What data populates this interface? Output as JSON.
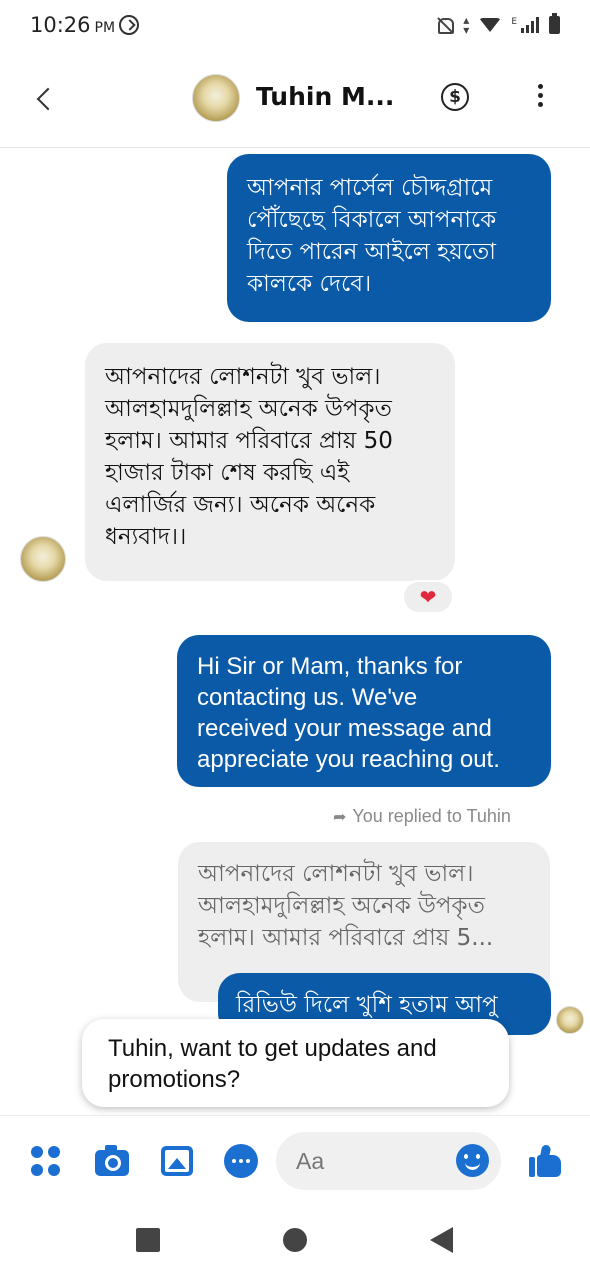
{
  "status_bar": {
    "time": "10:26",
    "ampm": "PM",
    "network_type": "E"
  },
  "header": {
    "contact_name": "Tuhin M...",
    "payment_symbol": "$"
  },
  "messages": [
    {
      "direction": "outgoing",
      "lines": [
        "আপনার পার্সেল চৌদ্দগ্রামে",
        "পৌঁছেছে বিকালে আপনাকে",
        "দিতে পারেন আইলে হয়তো",
        "কালকে দেবে।"
      ]
    },
    {
      "direction": "incoming",
      "lines": [
        "আপনাদের লোশনটা খুব ভাল।",
        "আলহামদুলিল্লাহ অনেক উপকৃত",
        "হলাম। আমার পরিবারে প্রায় 50",
        "হাজার টাকা শেষ করছি এই",
        "এলার্জির জন্য। অনেক অনেক",
        "ধন্যবাদ।।"
      ],
      "reaction": "heart"
    },
    {
      "direction": "outgoing",
      "lines": [
        "Hi Sir or Mam, thanks for",
        "contacting us. We've",
        "received your message and",
        "appreciate you reaching out."
      ]
    },
    {
      "direction": "outgoing",
      "reply_label": "You replied to Tuhin",
      "quoted_lines": [
        "আপনাদের লোশনটা খুব ভাল।",
        "আলহামদুলিল্লাহ অনেক উপকৃত",
        "হলাম। আমার পরিবারে প্রায় 5..."
      ],
      "lines": [
        "রিভিউ দিলে খুশি হতাম আপু"
      ]
    }
  ],
  "prompt_card": {
    "lines": [
      "Tuhin, want to get updates and",
      "promotions?"
    ]
  },
  "composer": {
    "placeholder": "Aa",
    "accent_color": "#1a6fd1"
  },
  "colors": {
    "outgoing_bubble": "#0a5aa8",
    "incoming_bubble": "#eeeeee",
    "heart": "#e0283c"
  }
}
